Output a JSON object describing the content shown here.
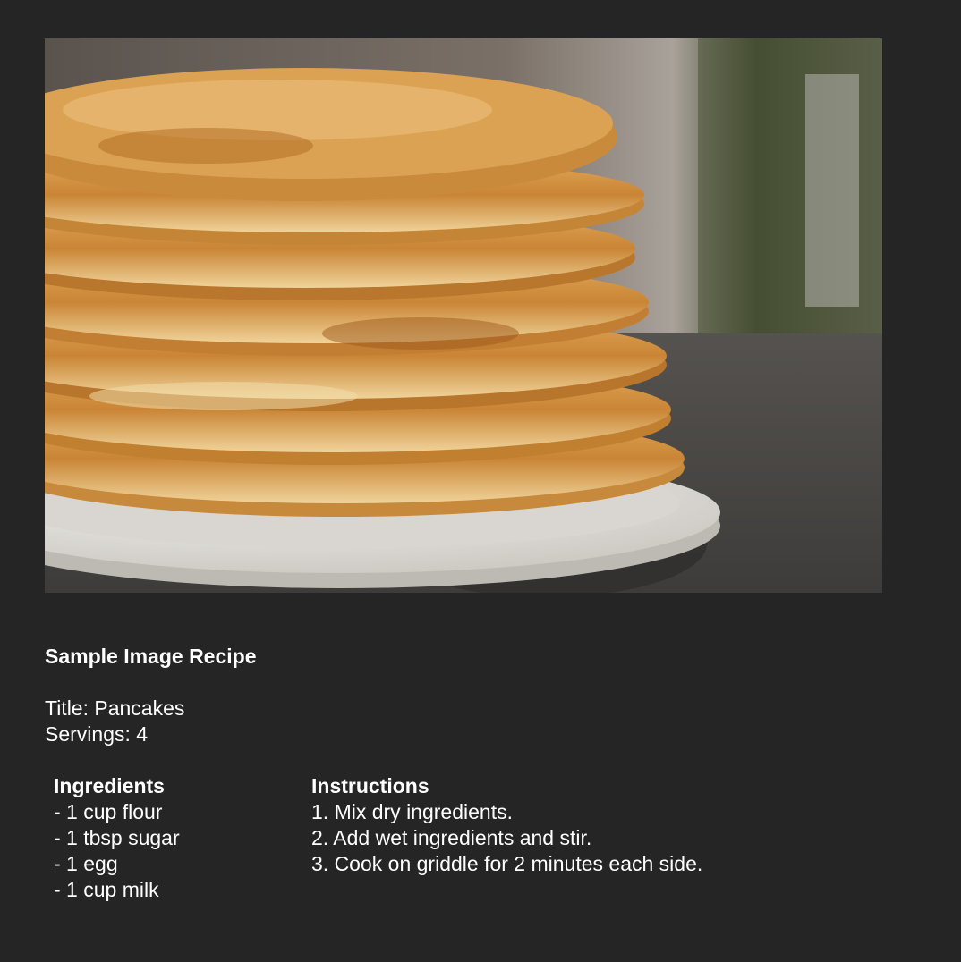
{
  "hero_image": {
    "description": "stack of pancakes on a white plate",
    "colors": {
      "background": "#252525",
      "pancake": "#d9a04a",
      "pancake_edge": "#f2d9a0",
      "plate": "#e8e6e2",
      "table": "#4a4846"
    }
  },
  "recipe": {
    "heading": "Sample Image Recipe",
    "title_line": "Title: Pancakes",
    "servings_line": "Servings: 4",
    "ingredients": {
      "title": "Ingredients",
      "items": [
        "- 1 cup flour",
        "- 1 tbsp sugar",
        "- 1 egg",
        "- 1 cup milk"
      ]
    },
    "instructions": {
      "title": "Instructions",
      "steps": [
        "1. Mix dry ingredients.",
        "2. Add wet ingredients and stir.",
        "3. Cook on griddle for 2 minutes each side."
      ]
    }
  }
}
